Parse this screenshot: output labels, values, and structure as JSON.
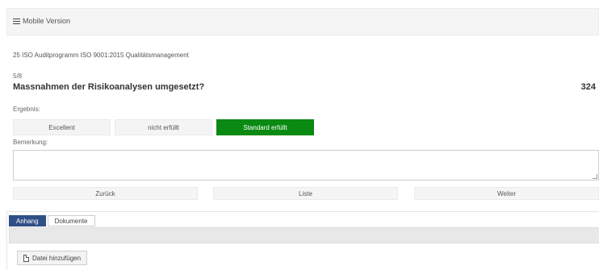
{
  "topbar": {
    "mobile_label": "Mobile Version"
  },
  "program": {
    "title": "25 ISO Auditprogramm ISO 9001:2015 Qualitätsmanagement"
  },
  "question": {
    "counter": "5/8",
    "text": "Massnahmen der Risikoanalysen umgesetzt?",
    "points": "324"
  },
  "result": {
    "label": "Ergebnis:",
    "options": [
      "Excellent",
      "nicht erfüllt",
      "Standard erfüllt"
    ],
    "selected": "Standard erfüllt",
    "selected_color": "#0a8a12"
  },
  "remark": {
    "label": "Bemerkung:",
    "value": ""
  },
  "navigation": {
    "back": "Zurück",
    "list": "Liste",
    "next": "Weiter"
  },
  "tabs": {
    "items": [
      "Anhang",
      "Dokumente"
    ],
    "active": "Anhang",
    "active_color": "#2f4f86"
  },
  "attachments": {
    "add_label": "Datei hinzufügen"
  },
  "icons": {
    "menu": "list-icon",
    "file": "file-icon"
  }
}
